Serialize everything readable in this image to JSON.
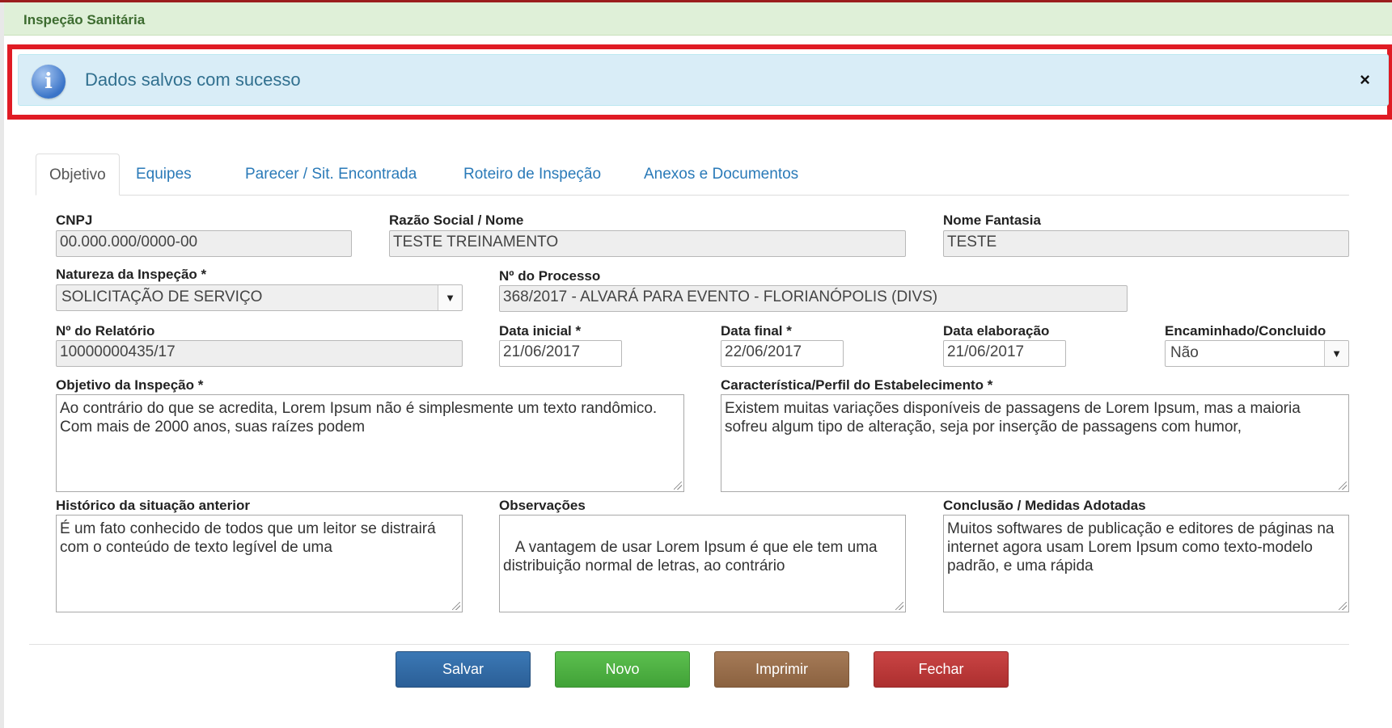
{
  "header": {
    "title": "Inspeção Sanitária"
  },
  "alert": {
    "icon": "info-icon",
    "glyph": "i",
    "message": "Dados salvos com sucesso",
    "close": "×"
  },
  "tabs": [
    {
      "label": "Objetivo",
      "active": true
    },
    {
      "label": "Equipes"
    },
    {
      "label": "Parecer / Sit. Encontrada"
    },
    {
      "label": "Roteiro de Inspeção"
    },
    {
      "label": "Anexos e Documentos"
    }
  ],
  "form": {
    "cnpj": {
      "label": "CNPJ",
      "value": "00.000.000/0000-00"
    },
    "razao_social": {
      "label": "Razão Social / Nome",
      "value": "TESTE TREINAMENTO"
    },
    "nome_fantasia": {
      "label": "Nome Fantasia",
      "value": "TESTE"
    },
    "natureza": {
      "label": "Natureza da Inspeção *",
      "value": "SOLICITAÇÃO DE SERVIÇO"
    },
    "processo": {
      "label": "Nº do Processo",
      "value": "368/2017 - ALVARÁ PARA EVENTO - FLORIANÓPOLIS (DIVS)"
    },
    "relatorio": {
      "label": "Nº do Relatório",
      "value": "10000000435/17"
    },
    "data_inicial": {
      "label": "Data inicial  *",
      "value": "21/06/2017"
    },
    "data_final": {
      "label": "Data final  *",
      "value": "22/06/2017"
    },
    "data_elaboracao": {
      "label": "Data elaboração",
      "value": "21/06/2017"
    },
    "encaminhado": {
      "label": "Encaminhado/Concluido",
      "value": "Não"
    },
    "objetivo": {
      "label": "Objetivo da Inspeção *",
      "value": "Ao contrário do que se acredita, Lorem Ipsum não é simplesmente um texto randômico. Com mais de 2000 anos, suas raízes podem"
    },
    "caracteristica": {
      "label": "Característica/Perfil do Estabelecimento *",
      "value": "Existem muitas variações disponíveis de passagens de Lorem Ipsum, mas a maioria sofreu algum tipo de alteração, seja por inserção de passagens com humor,"
    },
    "historico": {
      "label": "Histórico da situação anterior",
      "value": "É um fato conhecido de todos que um leitor se distrairá com o conteúdo de texto legível de uma"
    },
    "observacoes": {
      "label": "Observações",
      "value": " A vantagem de usar Lorem Ipsum é que ele tem uma distribuição normal de letras, ao contrário"
    },
    "conclusao": {
      "label": "Conclusão / Medidas Adotadas",
      "value": "Muitos softwares de publicação e editores de páginas na internet agora usam Lorem Ipsum como texto-modelo padrão, e uma rápida"
    }
  },
  "buttons": {
    "save": "Salvar",
    "new": "Novo",
    "print": "Imprimir",
    "close": "Fechar"
  },
  "colors": {
    "alert_bg": "#d9edf7",
    "alert_frame": "#e01b24",
    "header_bg": "#dff0d8",
    "link": "#2a7ab8"
  }
}
